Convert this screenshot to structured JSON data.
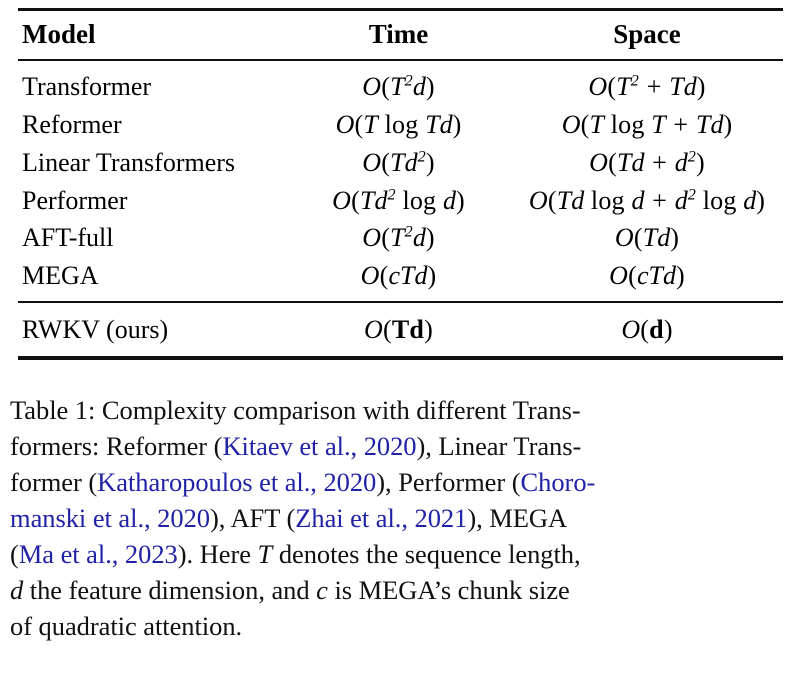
{
  "table": {
    "columns": [
      "Model",
      "Time",
      "Space"
    ],
    "rows": [
      {
        "model": "Transformer",
        "time": "O(T²d)",
        "space": "O(T² + Td)"
      },
      {
        "model": "Reformer",
        "time": "O(T log Td)",
        "space": "O(T log T + Td)"
      },
      {
        "model": "Linear Transformers",
        "time": "O(Td²)",
        "space": "O(Td + d²)"
      },
      {
        "model": "Performer",
        "time": "O(Td² log d)",
        "space": "O(Td log d + d² log d)"
      },
      {
        "model": "AFT-full",
        "time": "O(T²d)",
        "space": "O(Td)"
      },
      {
        "model": "MEGA",
        "time": "O(cTd)",
        "space": "O(cTd)"
      }
    ],
    "highlight_row": {
      "model": "RWKV (ours)",
      "time": "O(Td)",
      "space": "O(d)"
    }
  },
  "caption": {
    "label": "Table 1:",
    "text_1": "Complexity comparison with different Trans-",
    "text_2_pre": "formers: Reformer (",
    "cite_1": "Kitaev et al., 2020",
    "text_2_post": "), Linear Trans-",
    "text_3_pre": "former (",
    "cite_2": "Katharopoulos et al., 2020",
    "text_3_mid": "), Performer (",
    "cite_3_part1": "Choro-",
    "cite_3_part2": "manski et al., 2020",
    "text_4_mid": "), AFT (",
    "cite_4": "Zhai et al., 2021",
    "text_4_post": "), MEGA",
    "text_5_pre": "(",
    "cite_5": "Ma et al., 2023",
    "text_5_post": "). Here",
    "var_T": "T",
    "text_5_end": "denotes the sequence length,",
    "var_d": "d",
    "text_6_mid": "the feature dimension, and",
    "var_c": "c",
    "text_6_end": "is MEGA’s chunk size",
    "text_7": "of quadratic attention."
  },
  "colors": {
    "citation_link": "#2222a8",
    "text": "#111111",
    "rule": "#111111",
    "background": "#ffffff"
  }
}
